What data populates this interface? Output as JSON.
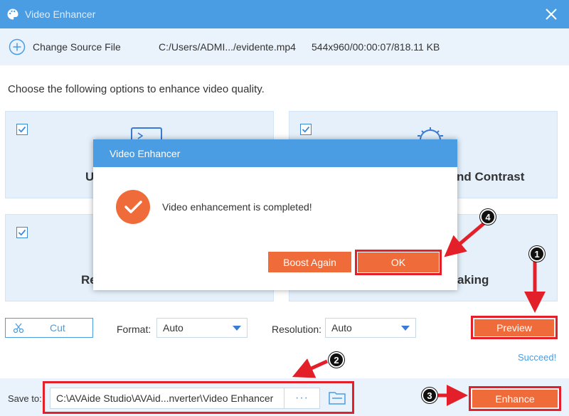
{
  "window": {
    "title": "Video Enhancer",
    "close_icon": "close-icon"
  },
  "source": {
    "change_label": "Change Source File",
    "path": "C:/Users/ADMI.../evidente.mp4",
    "meta": "544x960/00:00:07/818.11 KB"
  },
  "intro_text": "Choose the following options to enhance video quality.",
  "options": [
    {
      "label_visible": "U",
      "checked": true
    },
    {
      "label_visible": "nd Contrast",
      "checked": true
    },
    {
      "label_visible": "Re",
      "checked": true
    },
    {
      "label_visible": "aking",
      "checked": true
    }
  ],
  "toolbar": {
    "cut_label": "Cut",
    "format_label": "Format:",
    "format_value": "Auto",
    "resolution_label": "Resolution:",
    "resolution_value": "Auto",
    "preview_label": "Preview",
    "status": "Succeed!"
  },
  "save": {
    "label": "Save to:",
    "path": "C:\\AVAide Studio\\AVAid...nverter\\Video Enhancer",
    "browse": "···",
    "enhance_label": "Enhance"
  },
  "dialog": {
    "title": "Video Enhancer",
    "message": "Video enhancement is completed!",
    "boost_label": "Boost Again",
    "ok_label": "OK"
  },
  "annotations": {
    "badges": [
      "1",
      "2",
      "3",
      "4"
    ]
  },
  "colors": {
    "accent": "#4a9de3",
    "orange": "#f06b3a",
    "highlight": "#e3202a"
  }
}
